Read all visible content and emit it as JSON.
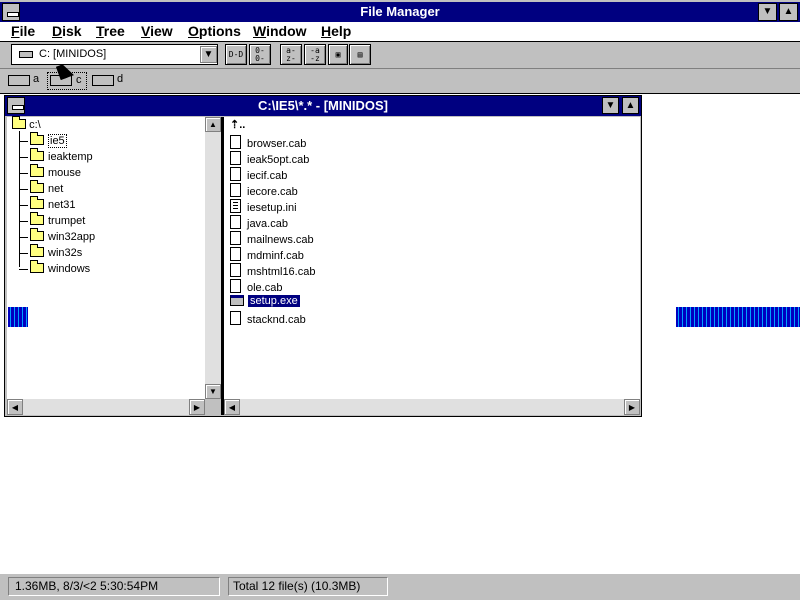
{
  "app": {
    "title": "File Manager"
  },
  "menu": [
    {
      "first": "F",
      "rest": "ile"
    },
    {
      "first": "D",
      "rest": "isk"
    },
    {
      "first": "T",
      "rest": "ree"
    },
    {
      "first": "V",
      "rest": "iew"
    },
    {
      "first": "O",
      "rest": "ptions"
    },
    {
      "first": "W",
      "rest": "indow"
    },
    {
      "first": "H",
      "rest": "elp"
    }
  ],
  "toolbar": {
    "drive_select_value": "C: [MINIDOS]"
  },
  "drives": [
    {
      "letter": "a"
    },
    {
      "letter": "c"
    },
    {
      "letter": "d"
    }
  ],
  "child_window": {
    "title": "C:\\IE5\\*.* - [MINIDOS]"
  },
  "tree": {
    "root": "c:\\",
    "items": [
      "ie5",
      "ieaktemp",
      "mouse",
      "net",
      "net31",
      "trumpet",
      "win32app",
      "win32s",
      "windows"
    ],
    "selected": "ie5"
  },
  "files": [
    {
      "name": "browser.cab",
      "icon": "document-icon"
    },
    {
      "name": "ieak5opt.cab",
      "icon": "document-icon"
    },
    {
      "name": "iecif.cab",
      "icon": "document-icon"
    },
    {
      "name": "iecore.cab",
      "icon": "document-icon"
    },
    {
      "name": "iesetup.ini",
      "icon": "text-document-icon"
    },
    {
      "name": "java.cab",
      "icon": "document-icon"
    },
    {
      "name": "mailnews.cab",
      "icon": "document-icon"
    },
    {
      "name": "mdminf.cab",
      "icon": "document-icon"
    },
    {
      "name": "mshtml16.cab",
      "icon": "document-icon"
    },
    {
      "name": "ole.cab",
      "icon": "document-icon"
    },
    {
      "name": "setup.exe",
      "icon": "program-icon",
      "selected": true
    },
    {
      "name": "stacknd.cab",
      "icon": "document-icon"
    }
  ],
  "status": {
    "left": "1.36MB, 8/3/<2 5:30:54PM",
    "right": "Total 12 file(s) (10.3MB)"
  },
  "colors": {
    "title_active": "#000080",
    "selection": "#000080",
    "folder": "#ffff80"
  }
}
